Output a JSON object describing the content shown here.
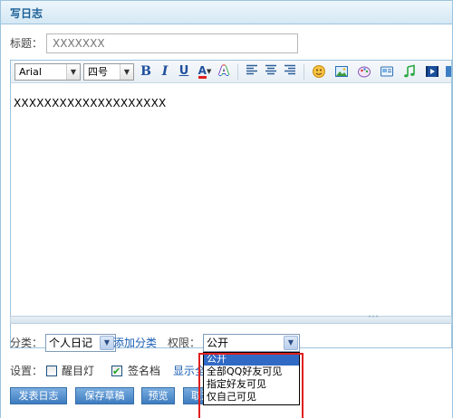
{
  "window": {
    "title": "写日志"
  },
  "form": {
    "title_label": "标题：",
    "title_placeholder": "XXXXXXX",
    "body_text": "XXXXXXXXXXXXXXXXXXXX"
  },
  "toolbar": {
    "font_name": "Arial",
    "font_size": "四号",
    "bold": "B",
    "italic": "I",
    "underline": "U",
    "font_color": "A",
    "highlight": "A"
  },
  "resize_handle": "˄˄˄",
  "category": {
    "label": "分类：",
    "value": "个人日记",
    "add_link": "添加分类"
  },
  "permission": {
    "label": "权限：",
    "value": "公开",
    "options": [
      "公开",
      "全部QQ好友可见",
      "指定好友可见",
      "仅自己可见"
    ]
  },
  "settings": {
    "label": "设置：",
    "reminder": "醒目灯",
    "signature": "签名档",
    "show_all": "显示全部"
  },
  "buttons": {
    "publish": "发表日志",
    "save_draft": "保存草稿",
    "preview": "预览",
    "cancel": "取消"
  },
  "colors": {
    "accent": "#1a5f96",
    "highlight_box": "#e0201e",
    "selected": "#316ac5"
  }
}
